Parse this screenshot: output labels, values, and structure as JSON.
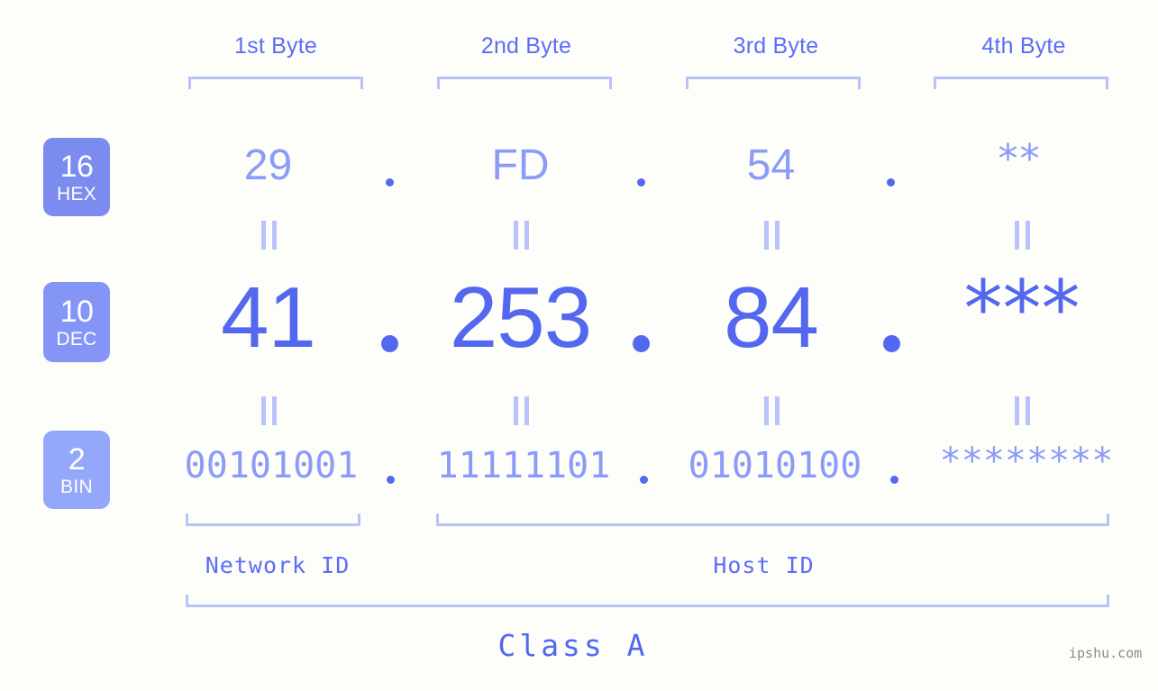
{
  "background_color": "#fdfdfa",
  "accent_color": "#5468ef",
  "accent_light": "#8b9bf7",
  "bracket_color": "#b9c2fb",
  "byte_headers": [
    {
      "label": "1st Byte"
    },
    {
      "label": "2nd Byte"
    },
    {
      "label": "3rd Byte"
    },
    {
      "label": "4th Byte"
    }
  ],
  "bases": [
    {
      "number": "16",
      "name": "HEX",
      "color": "#7b8bf0"
    },
    {
      "number": "10",
      "name": "DEC",
      "color": "#8595f5"
    },
    {
      "number": "2",
      "name": "BIN",
      "color": "#93a8fb"
    }
  ],
  "rows": {
    "hex": {
      "b1": "29",
      "b2": "FD",
      "b3": "54",
      "b4": "**"
    },
    "dec": {
      "b1": "41",
      "b2": "253",
      "b3": "84",
      "b4": "***"
    },
    "bin": {
      "b1": "00101001",
      "b2": "11111101",
      "b3": "01010100",
      "b4": "********"
    }
  },
  "separator": ".",
  "equals_connector": "||",
  "sections": [
    {
      "label": "Network ID"
    },
    {
      "label": "Host ID"
    }
  ],
  "class_label": "Class A",
  "watermark": "ipshu.com"
}
